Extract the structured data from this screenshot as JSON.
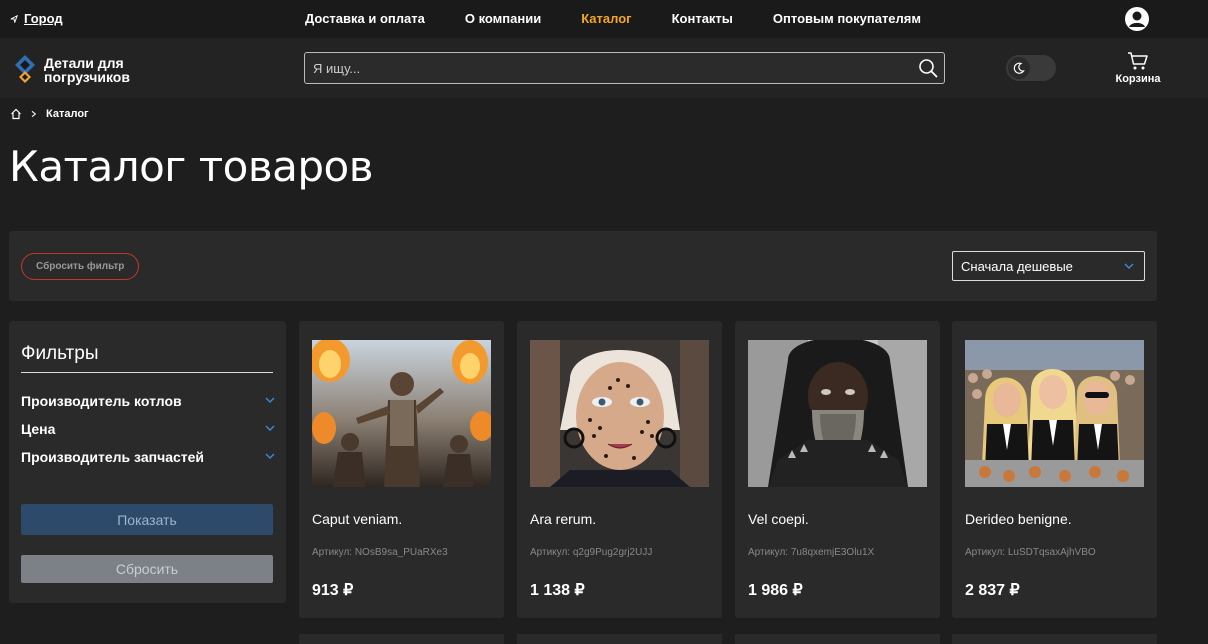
{
  "topbar": {
    "city_label": "Город",
    "nav": [
      {
        "label": "Доставка и оплата",
        "active": false
      },
      {
        "label": "О компании",
        "active": false
      },
      {
        "label": "Каталог",
        "active": true
      },
      {
        "label": "Контакты",
        "active": false
      },
      {
        "label": "Оптовым покупателям",
        "active": false
      }
    ],
    "accent_color": "#f5a623"
  },
  "header": {
    "logo_text": "Детали для погрузчиков",
    "search_placeholder": "Я ищу...",
    "cart_label": "Корзина"
  },
  "breadcrumb": {
    "current": "Каталог"
  },
  "page_title": "Каталог товаров",
  "filterbar": {
    "reset_label": "Сбросить фильтр",
    "sort_value": "Сначала дешевые"
  },
  "sidebar": {
    "title": "Фильтры",
    "facets": [
      "Производитель котлов",
      "Цена",
      "Производитель запчастей"
    ],
    "show_label": "Показать",
    "reset_label": "Сбросить"
  },
  "products": [
    {
      "title": "Caput veniam.",
      "sku": "Артикул: NOsB9sa_PUaRXe3",
      "price": "913 ₽"
    },
    {
      "title": "Ara rerum.",
      "sku": "Артикул: q2g9Pug2grj2UJJ",
      "price": "1 138 ₽"
    },
    {
      "title": "Vel coepi.",
      "sku": "Артикул: 7u8qxemjE3Olu1X",
      "price": "1 986 ₽"
    },
    {
      "title": "Derideo benigne.",
      "sku": "Артикул: LuSDTqsaxAjhVBO",
      "price": "2 837 ₽"
    }
  ]
}
